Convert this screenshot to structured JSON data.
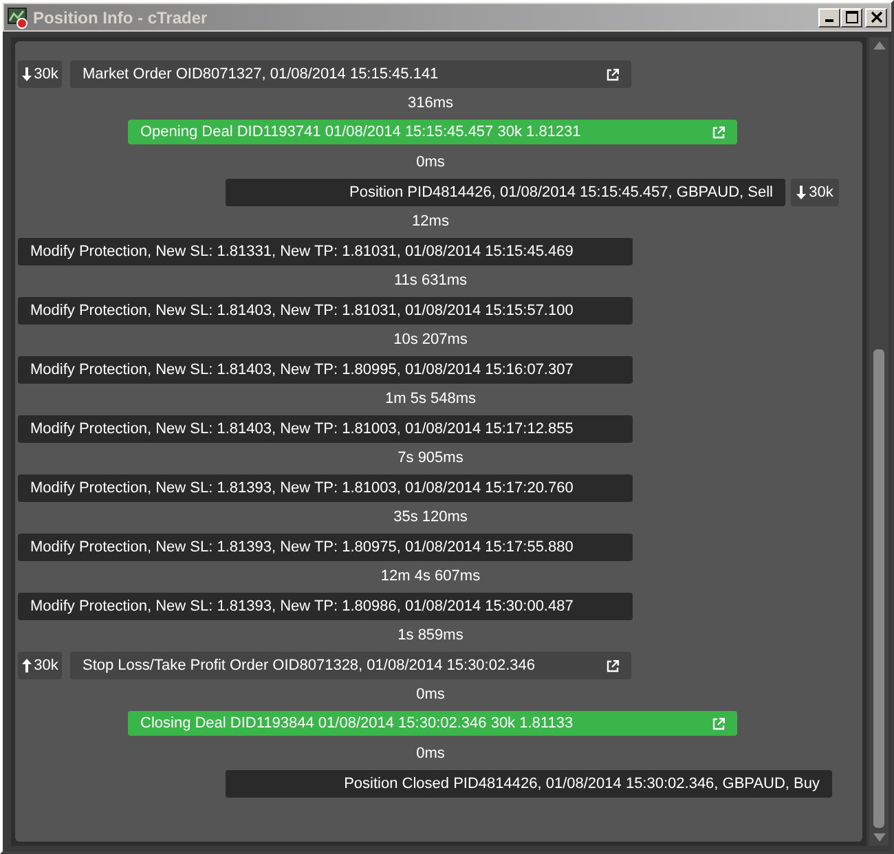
{
  "window": {
    "title": "Position Info - cTrader"
  },
  "events": [
    {
      "kind": "order",
      "up": false,
      "volume": "30k",
      "text": "Market Order OID8071327, 01/08/2014 15:15:45.141",
      "delay": "316ms"
    },
    {
      "kind": "deal",
      "text": "Opening Deal DID1193741 01/08/2014 15:15:45.457 30k 1.81231",
      "delay": "0ms"
    },
    {
      "kind": "position",
      "up": false,
      "volume": "30k",
      "text": "Position PID4814426, 01/08/2014 15:15:45.457, GBPAUD, Sell",
      "delay": "12ms"
    },
    {
      "kind": "modify",
      "text": "Modify Protection, New SL: 1.81331, New TP: 1.81031, 01/08/2014 15:15:45.469",
      "delay": "11s 631ms"
    },
    {
      "kind": "modify",
      "text": "Modify Protection, New SL: 1.81403, New TP: 1.81031, 01/08/2014 15:15:57.100",
      "delay": "10s 207ms"
    },
    {
      "kind": "modify",
      "text": "Modify Protection, New SL: 1.81403, New TP: 1.80995, 01/08/2014 15:16:07.307",
      "delay": "1m 5s 548ms"
    },
    {
      "kind": "modify",
      "text": "Modify Protection, New SL: 1.81403, New TP: 1.81003, 01/08/2014 15:17:12.855",
      "delay": "7s 905ms"
    },
    {
      "kind": "modify",
      "text": "Modify Protection, New SL: 1.81393, New TP: 1.81003, 01/08/2014 15:17:20.760",
      "delay": "35s 120ms"
    },
    {
      "kind": "modify",
      "text": "Modify Protection, New SL: 1.81393, New TP: 1.80975, 01/08/2014 15:17:55.880",
      "delay": "12m 4s 607ms"
    },
    {
      "kind": "modify",
      "text": "Modify Protection, New SL: 1.81393, New TP: 1.80986, 01/08/2014 15:30:00.487",
      "delay": "1s 859ms"
    },
    {
      "kind": "order",
      "up": true,
      "volume": "30k",
      "text": "Stop Loss/Take Profit Order OID8071328, 01/08/2014 15:30:02.346",
      "delay": "0ms"
    },
    {
      "kind": "deal",
      "text": "Closing Deal DID1193844 01/08/2014 15:30:02.346 30k 1.81133",
      "delay": "0ms"
    },
    {
      "kind": "closed",
      "text": "Position Closed PID4814426, 01/08/2014 15:30:02.346, GBPAUD, Buy"
    }
  ]
}
